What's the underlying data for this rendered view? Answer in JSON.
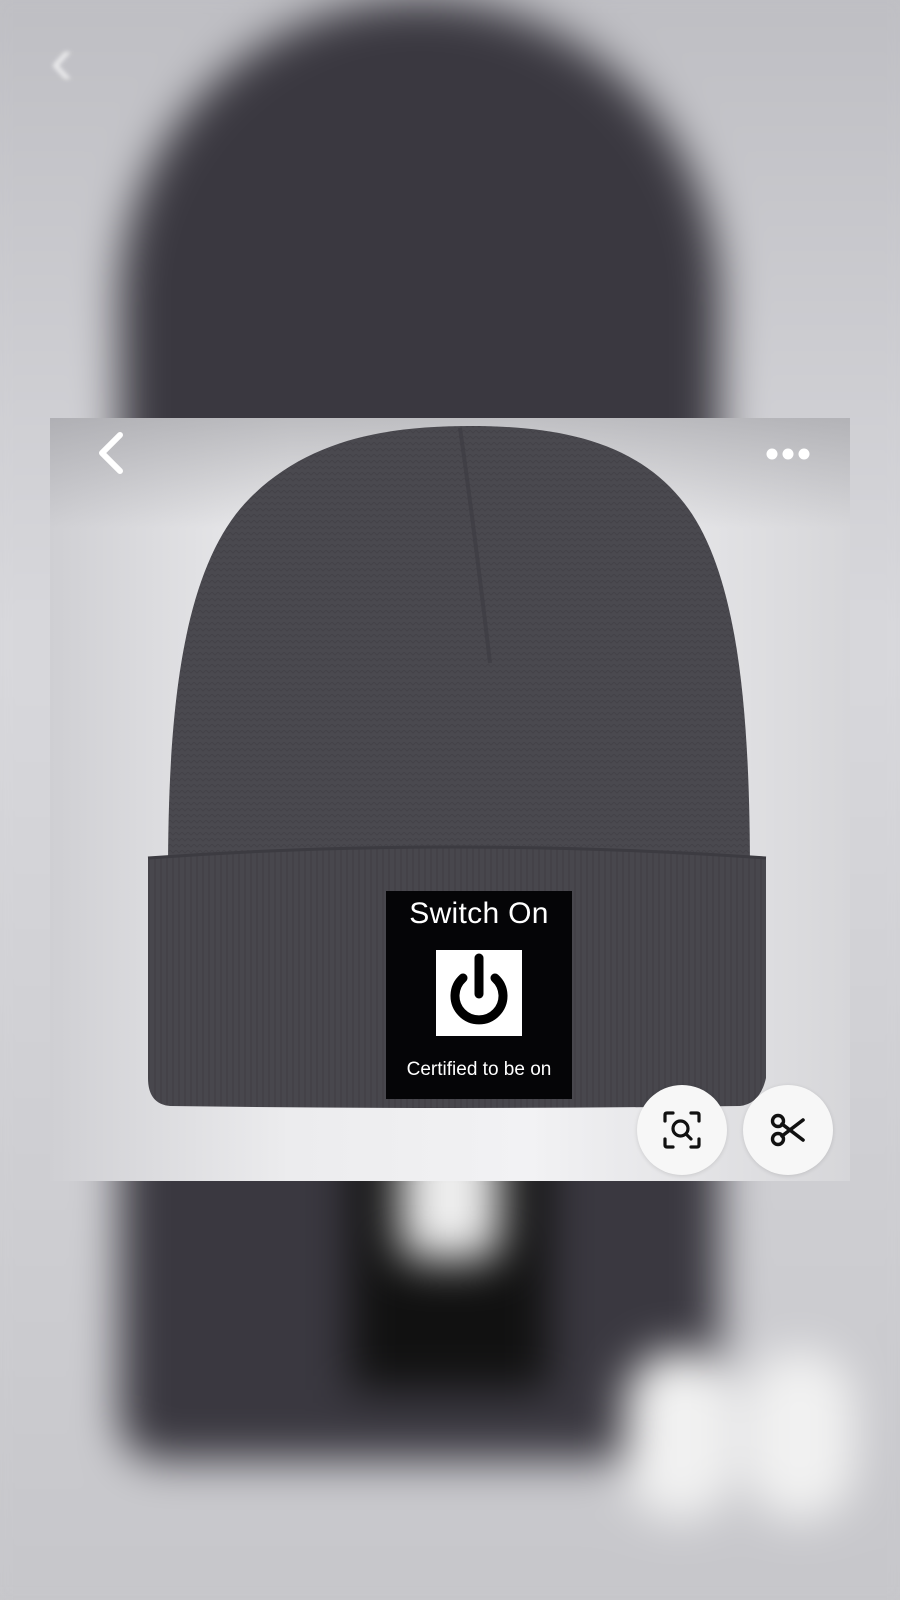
{
  "product": {
    "image_alt": "Dark grey knit beanie with black label patch",
    "label": {
      "title": "Switch On",
      "caption": "Certified to be on"
    }
  },
  "toolbar": {
    "back_icon": "chevron-left-icon",
    "more_icon": "more-horizontal-icon"
  },
  "actions": {
    "visual_search_icon": "image-search-icon",
    "crop_icon": "scissors-icon"
  },
  "colors": {
    "hat": "#4a494f",
    "label_bg": "#050507",
    "button_bg": "#f7f7f7"
  }
}
